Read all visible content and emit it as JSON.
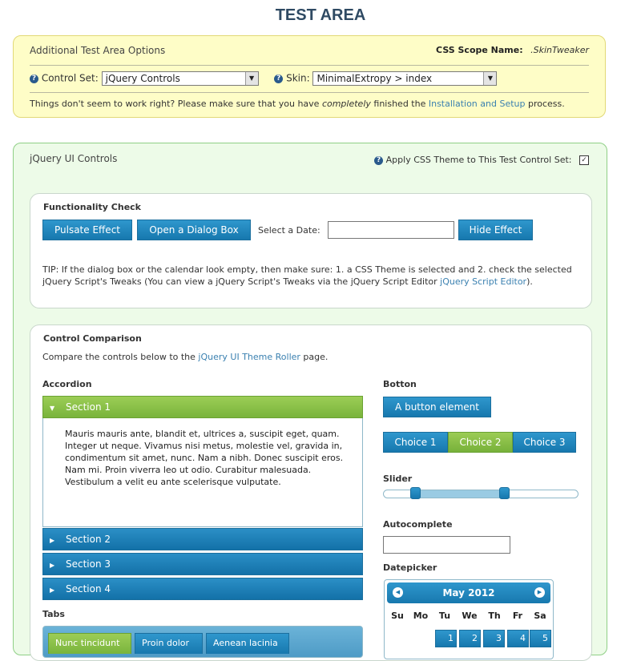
{
  "page_title": "TEST AREA",
  "options": {
    "heading": "Additional Test Area Options",
    "scope_label": "CSS Scope Name:",
    "scope_value": ".SkinTweaker",
    "control_set_label": "Control Set:",
    "control_set_value": "jQuery Controls",
    "skin_label": "Skin:",
    "skin_value": "MinimalExtropy > index",
    "note_before": "Things don't seem to work right? Please make sure that you have",
    "note_em": "completely",
    "note_mid": "finished the",
    "note_link": "Installation and Setup",
    "note_after": "process."
  },
  "controls": {
    "heading": "jQuery UI Controls",
    "apply_label": "Apply CSS Theme to This Test Control Set:",
    "apply_checked": "✓"
  },
  "functionality": {
    "heading": "Functionality Check",
    "pulsate": "Pulsate Effect",
    "dialog": "Open a Dialog Box",
    "date_label": "Select a Date:",
    "hide": "Hide Effect",
    "tip": "TIP: If the dialog box or the calendar look empty, then make sure: 1. a CSS Theme is selected and 2. check the selected jQuery Script's Tweaks (You can view a jQuery Script's Tweaks via the jQuery Script Editor",
    "tip_link": "jQuery Script Editor",
    "tip_end": ")."
  },
  "comparison": {
    "heading": "Control Comparison",
    "intro_before": "Compare the controls below to the",
    "intro_link": "jQuery UI Theme Roller",
    "intro_after": "page.",
    "accordion_label": "Accordion",
    "sections": [
      "Section 1",
      "Section 2",
      "Section 3",
      "Section 4"
    ],
    "section1_text": "Mauris mauris ante, blandit et, ultrices a, suscipit eget, quam. Integer ut neque. Vivamus nisi metus, molestie vel, gravida in, condimentum sit amet, nunc. Nam a nibh. Donec suscipit eros. Nam mi. Proin viverra leo ut odio. Curabitur malesuada. Vestibulum a velit eu ante scelerisque vulputate.",
    "tabs_label": "Tabs",
    "tabs": [
      "Nunc tincidunt",
      "Proin dolor",
      "Aenean lacinia"
    ],
    "button_label": "Botton",
    "button_element": "A button element",
    "choices": [
      "Choice 1",
      "Choice 2",
      "Choice 3"
    ],
    "slider_label": "Slider",
    "slider_range": [
      16,
      62
    ],
    "autocomplete_label": "Autocomplete",
    "datepicker_label": "Datepicker",
    "month": "May 2012",
    "dow": [
      "Su",
      "Mo",
      "Tu",
      "We",
      "Th",
      "Fr",
      "Sa"
    ],
    "days": [
      "1",
      "2",
      "3",
      "4",
      "5"
    ]
  }
}
